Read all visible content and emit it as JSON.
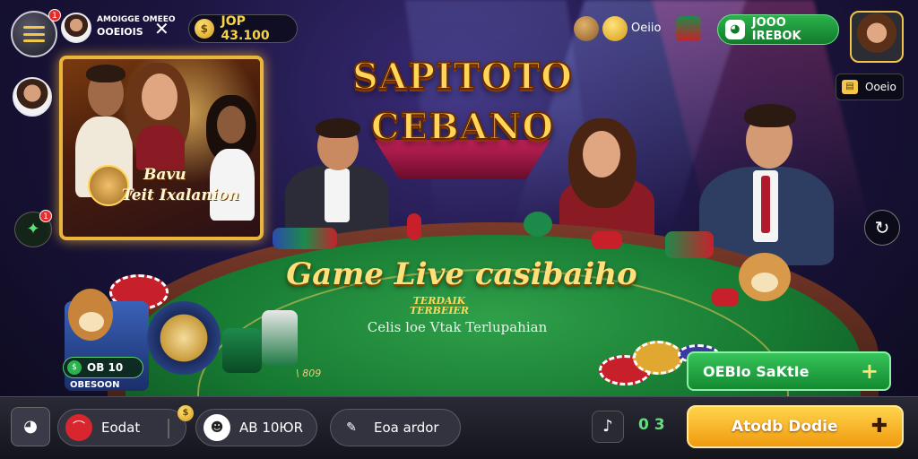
{
  "topbar": {
    "notification_count": "1",
    "user_name_line1": "AMOIGGE OMEEO",
    "user_name_line2": "OOEIOIS",
    "close_glyph": "✕",
    "coin_balance": "JOP 43.100",
    "dim_label": "Oeiio",
    "green_pill_label": "JOOO IREBOK",
    "side_badge_label": "Ooeio"
  },
  "promo": {
    "title_line1": "Bavu",
    "title_line2": "Teit Ixalanion"
  },
  "logo": {
    "line1": "SAPITOTO",
    "line2": "CEBANO"
  },
  "table": {
    "title": "Game Live casibaiho",
    "small_line1": "TERDAIK",
    "small_line2": "TERBEIER",
    "description": "Celis loe Vtak Terlupahian",
    "felt_number": "\\ 809"
  },
  "balance": {
    "value": "OB 10",
    "sub_label": "OBESOON"
  },
  "join_button": {
    "label": "OEBIo SaKtIe",
    "plus": "+"
  },
  "bottom_bar": {
    "btn1_label": "Eodat",
    "btn1_badge": "$",
    "btn2_label": "AB 10ЮR",
    "btn3_label": "Eoa ardor",
    "percent": "0 3",
    "play_label": "Atodb Dodie",
    "play_icon": "✚"
  },
  "icons": {
    "menu": "menu-icon",
    "chip": "poker-chip-icon",
    "coin": "gold-coin-icon",
    "gift": "gift-icon",
    "music": "music-note-icon",
    "refresh": "refresh-icon",
    "dog": "dog-mascot-icon"
  },
  "colors": {
    "accent_gold": "#ffd658",
    "felt_green": "#177a32",
    "button_green": "#2bb24c",
    "button_orange": "#f09a10"
  }
}
